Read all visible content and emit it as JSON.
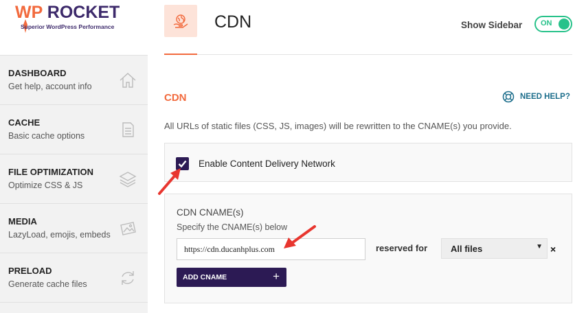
{
  "brand": {
    "name_prefix": "WP",
    "name_main": " ROCKET",
    "tagline": "Superior WordPress Performance",
    "accent": "#f26a3d",
    "dark": "#2c1a54"
  },
  "sidebar": {
    "items": [
      {
        "title": "DASHBOARD",
        "subtitle": "Get help, account info",
        "icon": "home-icon"
      },
      {
        "title": "CACHE",
        "subtitle": "Basic cache options",
        "icon": "document-icon"
      },
      {
        "title": "FILE OPTIMIZATION",
        "subtitle": "Optimize CSS & JS",
        "icon": "layers-icon"
      },
      {
        "title": "MEDIA",
        "subtitle": "LazyLoad, emojis, embeds",
        "icon": "image-icon"
      },
      {
        "title": "PRELOAD",
        "subtitle": "Generate cache files",
        "icon": "refresh-icon"
      }
    ]
  },
  "header": {
    "title": "CDN",
    "icon": "cdn-globe-hand-icon",
    "show_sidebar_label": "Show Sidebar",
    "toggle_label": "ON"
  },
  "section": {
    "title": "CDN",
    "help_label": "NEED HELP?",
    "description": "All URLs of static files (CSS, JS, images) will be rewritten to the CNAME(s) you provide."
  },
  "enable_cdn": {
    "label": "Enable Content Delivery Network",
    "checked": true
  },
  "cname": {
    "title": "CDN CNAME(s)",
    "description": "Specify the CNAME(s) below",
    "input_value": "https://cdn.ducanhplus.com",
    "reserved_label": "reserved for",
    "selected_option": "All files",
    "remove_label": "×",
    "add_button_label": "ADD CNAME",
    "add_button_plus": "+"
  }
}
